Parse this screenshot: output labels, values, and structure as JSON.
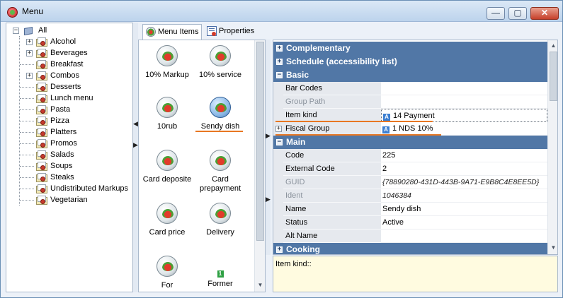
{
  "window": {
    "title": "Menu",
    "min_glyph": "—",
    "max_glyph": "▢",
    "close_glyph": "✕"
  },
  "tree": {
    "root": "All",
    "items": [
      {
        "label": "Alcohol",
        "expandable": true
      },
      {
        "label": "Beverages",
        "expandable": true
      },
      {
        "label": "Breakfast",
        "expandable": false
      },
      {
        "label": "Combos",
        "expandable": true
      },
      {
        "label": "Desserts",
        "expandable": false
      },
      {
        "label": "Lunch menu",
        "expandable": false
      },
      {
        "label": "Pasta",
        "expandable": false
      },
      {
        "label": "Pizza",
        "expandable": false
      },
      {
        "label": "Platters",
        "expandable": false
      },
      {
        "label": "Promos",
        "expandable": false
      },
      {
        "label": "Salads",
        "expandable": false
      },
      {
        "label": "Soups",
        "expandable": false
      },
      {
        "label": "Steaks",
        "expandable": false
      },
      {
        "label": "Undistributed Markups",
        "expandable": false
      },
      {
        "label": "Vegetarian",
        "expandable": false
      }
    ]
  },
  "tabs": [
    {
      "label": "Menu Items",
      "active": true
    },
    {
      "label": "Properties",
      "active": false
    }
  ],
  "menu_items": [
    {
      "label": "10% Markup"
    },
    {
      "label": "10% service"
    },
    {
      "label": "10rub"
    },
    {
      "label": "Sendy dish",
      "selected": true
    },
    {
      "label": "Card deposite"
    },
    {
      "label": "Card prepayment"
    },
    {
      "label": "Card price"
    },
    {
      "label": "Delivery"
    },
    {
      "label": "For"
    },
    {
      "label": "Former",
      "badge": "1"
    }
  ],
  "properties": {
    "categories": {
      "complementary": "Complementary",
      "schedule": "Schedule (accessibility list)",
      "basic": "Basic",
      "main": "Main",
      "cooking": "Cooking"
    },
    "rows": {
      "bar_codes": {
        "name": "Bar Codes",
        "value": ""
      },
      "group_path": {
        "name": "Group Path",
        "value": ""
      },
      "item_kind": {
        "name": "Item kind",
        "value": "14 Payment"
      },
      "fiscal_group": {
        "name": "Fiscal Group",
        "value": "1 NDS 10%"
      },
      "code": {
        "name": "Code",
        "value": "225"
      },
      "external_code": {
        "name": "External Code",
        "value": "2"
      },
      "guid": {
        "name": "GUID",
        "value": "{78890280-431D-443B-9A71-E9B8C4E8EE5D}"
      },
      "ident": {
        "name": "Ident",
        "value": "1046384"
      },
      "name": {
        "name": "Name",
        "value": "Sendy dish"
      },
      "status": {
        "name": "Status",
        "value": "Active"
      },
      "alt_name": {
        "name": "Alt Name",
        "value": ""
      }
    }
  },
  "description": {
    "text": "Item kind::"
  },
  "colors": {
    "accent": "#5177a6",
    "highlight_underline": "#e87722",
    "desc_bg": "#fffbe0"
  }
}
